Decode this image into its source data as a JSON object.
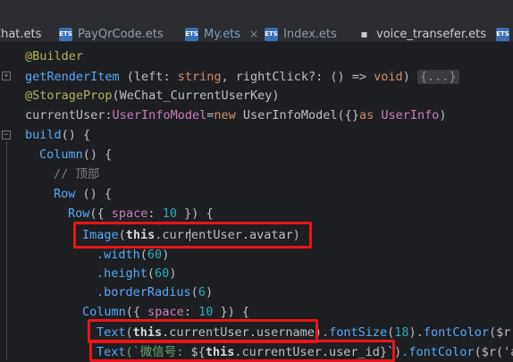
{
  "tabs": [
    {
      "label": "Chat.ets"
    },
    {
      "label": "PayQrCode.ets"
    },
    {
      "label": "My.ets",
      "active": true
    },
    {
      "label": "Index.ets"
    },
    {
      "label": "voice_transefer.ets"
    }
  ],
  "tab_icon_text": "ETS",
  "close_glyph": "×",
  "code": {
    "l1": {
      "annot": "@Builder"
    },
    "l2": {
      "fn": "getRenderItem",
      "p1": " (left: ",
      "t1": "string",
      "p2": ", rightClick?: () => ",
      "t2": "void",
      "p3": ") ",
      "folded": "{...}"
    },
    "l3": {
      "annot": "@StorageProp",
      "p1": "(WeChat_CurrentUserKey)"
    },
    "l4": {
      "a": "currentUser:",
      "t1": "UserInfoModel",
      "b": "=",
      "kw": "new ",
      "c": "UserInfoModel",
      "d": "({}",
      "kw2": "as ",
      "t2": "UserInfo",
      "e": ")"
    },
    "l5": {
      "fn": "build",
      "p": "() {"
    },
    "l6": {
      "fn": "Column",
      "p": "() {"
    },
    "l7": {
      "comment": "// 顶部"
    },
    "l8": {
      "fn": "Row",
      "p": " () {"
    },
    "l9": {
      "fn": "Row",
      "a": "({ ",
      "prop": "space",
      "b": ": ",
      "num": "10",
      "c": " }) {"
    },
    "l10": {
      "fn": "Image",
      "a": "(",
      "kw": "this",
      "b": ".currentUser.avatar)"
    },
    "l11": {
      "fn": ".width",
      "a": "(",
      "num": "60",
      "b": ")"
    },
    "l12": {
      "fn": ".height",
      "a": "(",
      "num": "60",
      "b": ")"
    },
    "l13": {
      "fn": ".borderRadius",
      "a": "(",
      "num": "6",
      "b": ")"
    },
    "l14": {
      "fn": "Column",
      "a": "({ ",
      "prop": "space",
      "b": ": ",
      "num": "10",
      "c": " }) {"
    },
    "l15": {
      "fn": "Text",
      "a": "(",
      "kw": "this",
      "b": ".currentUser.username)",
      "fn2": ".fontSize",
      "c": "(",
      "num": "18",
      "d": ").",
      "fn3": "fontColor",
      "e": "($r("
    },
    "l16": {
      "fn": "Text",
      "a": "(`",
      "str": "微信号: ",
      "b": "${",
      "kw": "this",
      "c": ".currentUser.user_id",
      "d": "}`)",
      "fn2": ".fontColor",
      "e": "($r('ap"
    }
  }
}
